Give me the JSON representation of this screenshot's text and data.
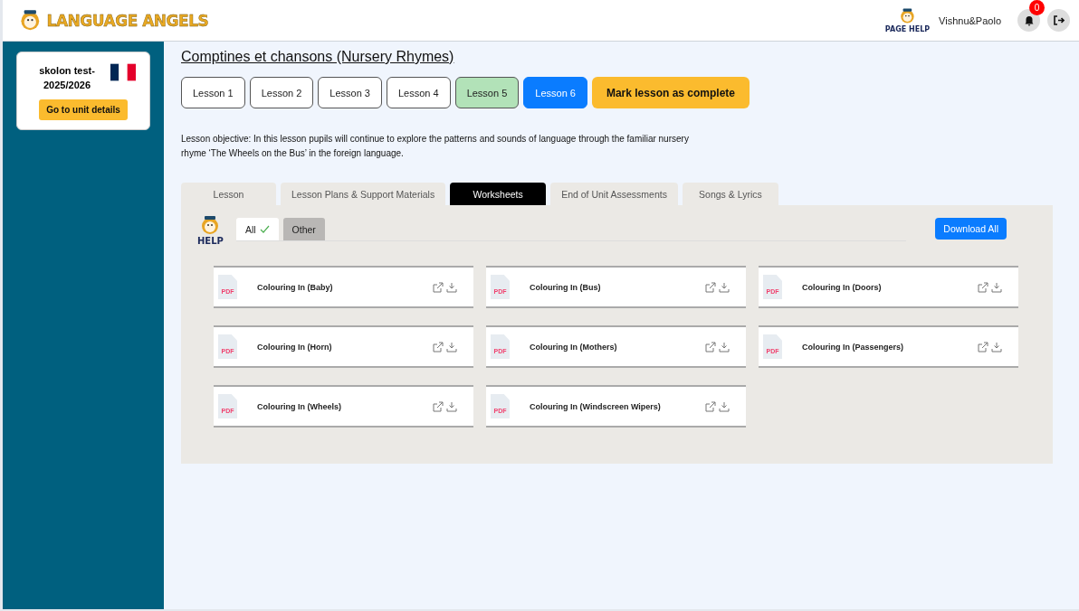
{
  "header": {
    "logo_text": "LANGUAGE ANGELS",
    "page_help": "PAGE HELP",
    "user": "Vishnu&Paolo",
    "notifications": "0"
  },
  "sidebar": {
    "class_name": "skolon test-2025/2026",
    "button": "Go to unit details"
  },
  "unit_title": "Comptines et chansons (Nursery Rhymes)",
  "lessons": [
    {
      "label": "Lesson 1",
      "selected": false,
      "completed": false
    },
    {
      "label": "Lesson 2",
      "selected": false,
      "completed": false
    },
    {
      "label": "Lesson 3",
      "selected": false,
      "completed": false
    },
    {
      "label": "Lesson 4",
      "selected": false,
      "completed": false
    },
    {
      "label": "Lesson 5",
      "selected": false,
      "completed": true
    },
    {
      "label": "Lesson 6",
      "selected": true,
      "completed": false
    }
  ],
  "mark_complete": "Mark lesson as complete",
  "objective": "Lesson objective: In this lesson pupils will continue to explore the patterns and sounds of language through the familiar nursery rhyme ‘The Wheels on the Bus’ in the foreign language.",
  "tabs": [
    {
      "label": "Lesson",
      "selected": false
    },
    {
      "label": "Lesson Plans & Support Materials",
      "selected": false
    },
    {
      "label": "Worksheets",
      "selected": true
    },
    {
      "label": "End of Unit Assessments",
      "selected": false
    },
    {
      "label": "Songs & Lyrics",
      "selected": false
    }
  ],
  "help_label": "HELP",
  "filters": [
    {
      "label": "All",
      "selected": true
    },
    {
      "label": "Other",
      "selected": false
    }
  ],
  "download_all": "Download All",
  "files": [
    {
      "type": "PDF",
      "name": "Colouring In (Baby)"
    },
    {
      "type": "PDF",
      "name": "Colouring In (Bus)"
    },
    {
      "type": "PDF",
      "name": "Colouring In (Doors)"
    },
    {
      "type": "PDF",
      "name": "Colouring In (Horn)"
    },
    {
      "type": "PDF",
      "name": "Colouring In (Mothers)"
    },
    {
      "type": "PDF",
      "name": "Colouring In (Passengers)"
    },
    {
      "type": "PDF",
      "name": "Colouring In (Wheels)"
    },
    {
      "type": "PDF",
      "name": "Colouring In (Windscreen Wipers)"
    }
  ]
}
